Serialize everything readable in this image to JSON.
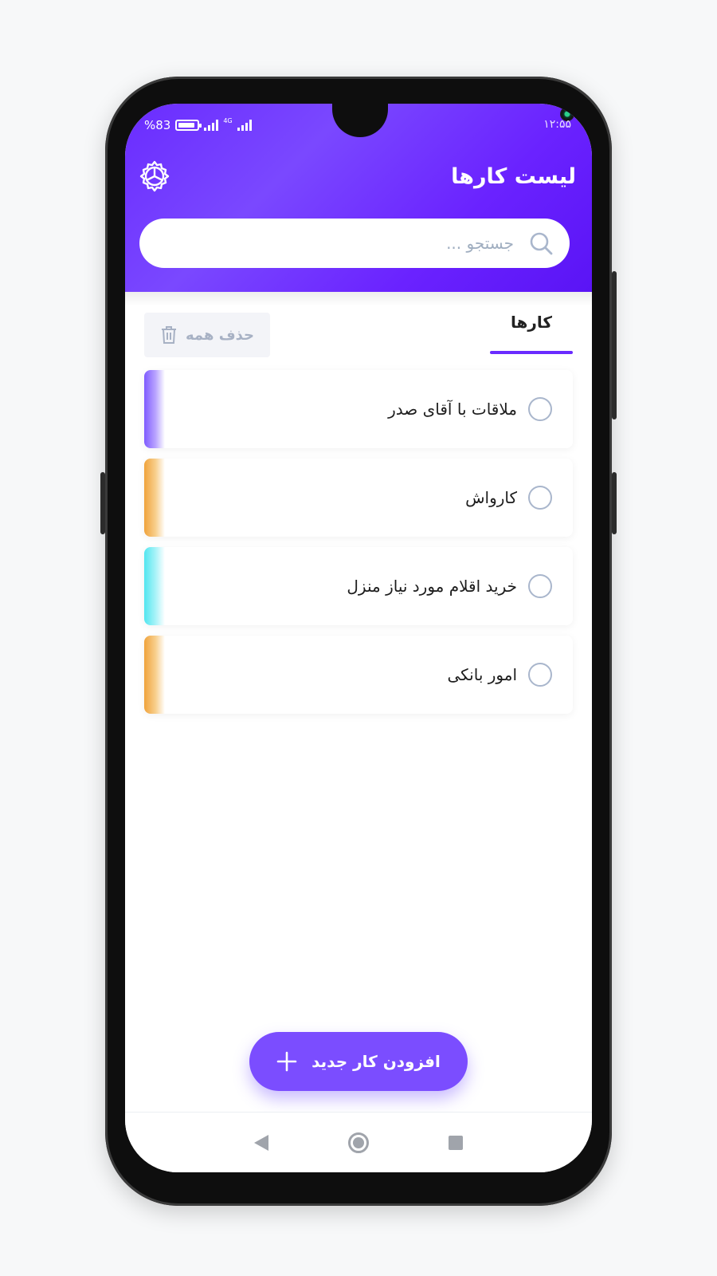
{
  "status_bar": {
    "battery_text": "%83",
    "network_type": "4G",
    "time": "۱۲:۵۵"
  },
  "header": {
    "title": "لیست کارها",
    "settings_icon": "gear-icon",
    "color": "#6a2cff"
  },
  "search": {
    "placeholder": "جستجو ...",
    "value": "",
    "icon": "search-icon"
  },
  "tabs": {
    "active_label": "کارها"
  },
  "toolbar": {
    "delete_all_label": "حذف همه",
    "delete_icon": "trash-icon"
  },
  "tasks": [
    {
      "label": "ملاقات با آقای صدر",
      "accent": "#7f5cff",
      "done": false
    },
    {
      "label": "کارواش",
      "accent": "#f0a33c",
      "done": false
    },
    {
      "label": "خرید اقلام مورد نیاز منزل",
      "accent": "#52e6f0",
      "done": false
    },
    {
      "label": "امور بانکی",
      "accent": "#f0a33c",
      "done": false
    }
  ],
  "fab": {
    "label": "افزودن کار جدید",
    "icon": "plus-icon",
    "color": "#7b4dff"
  },
  "nav": {
    "back_icon": "back-icon",
    "home_icon": "home-icon",
    "recents_icon": "recents-icon"
  }
}
